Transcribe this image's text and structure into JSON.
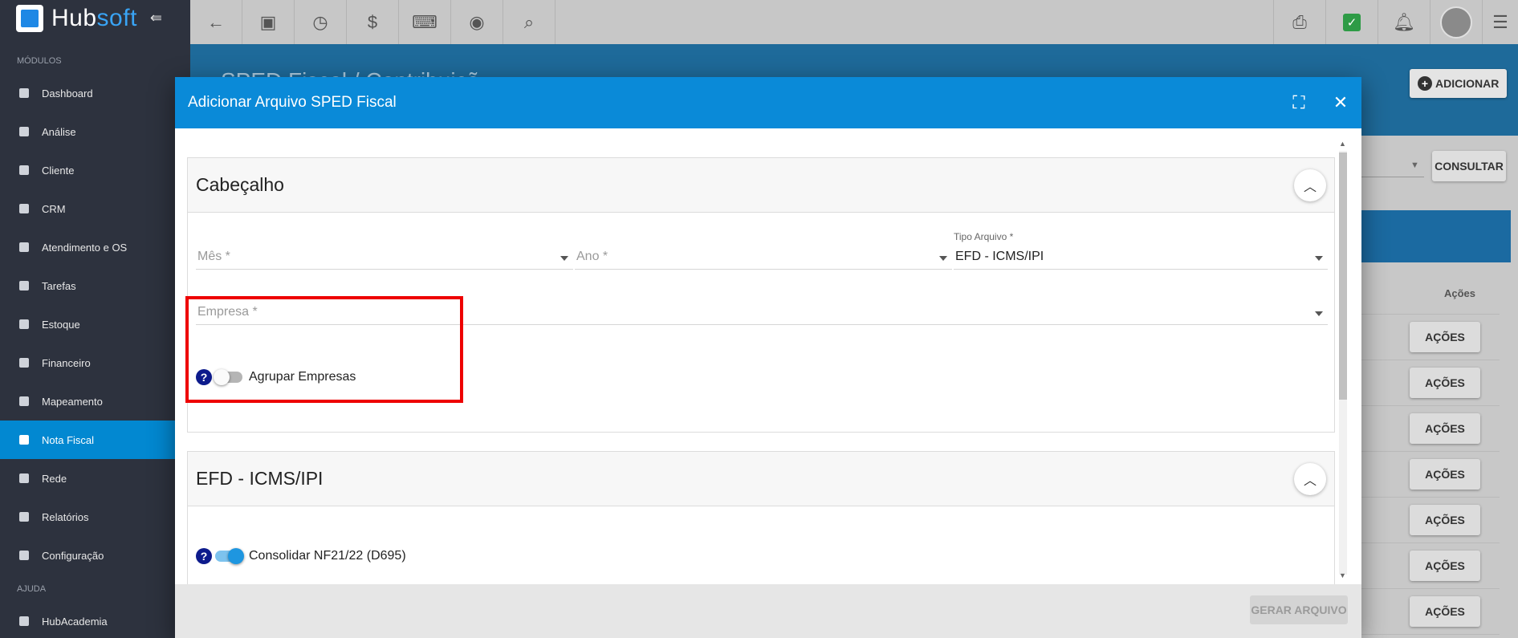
{
  "app": {
    "brand_hub": "Hub",
    "brand_soft": "soft",
    "collapse_icon": "⇚"
  },
  "sidebar": {
    "section_modules": "MÓDULOS",
    "section_help": "AJUDA",
    "items": [
      {
        "label": "Dashboard",
        "icon": "dashboard-icon",
        "has_chevron": false
      },
      {
        "label": "Análise",
        "icon": "pie-chart-icon",
        "has_chevron": false
      },
      {
        "label": "Cliente",
        "icon": "contact-card-icon",
        "has_chevron": true
      },
      {
        "label": "CRM",
        "icon": "kanban-icon",
        "has_chevron": false
      },
      {
        "label": "Atendimento e OS",
        "icon": "calendar-clock-icon",
        "has_chevron": false
      },
      {
        "label": "Tarefas",
        "icon": "task-icon",
        "has_chevron": false
      },
      {
        "label": "Estoque",
        "icon": "box-icon",
        "has_chevron": false
      },
      {
        "label": "Financeiro",
        "icon": "money-icon",
        "has_chevron": false
      },
      {
        "label": "Mapeamento",
        "icon": "map-pin-icon",
        "has_chevron": false
      },
      {
        "label": "Nota Fiscal",
        "icon": "invoice-icon",
        "has_chevron": false,
        "active": true
      },
      {
        "label": "Rede",
        "icon": "server-icon",
        "has_chevron": false
      },
      {
        "label": "Relatórios",
        "icon": "report-icon",
        "has_chevron": false
      },
      {
        "label": "Configuração",
        "icon": "gear-icon",
        "has_chevron": true
      }
    ],
    "help_items": [
      {
        "label": "HubAcademia",
        "icon": "video-icon"
      }
    ]
  },
  "topbar": {
    "left_icons": [
      "back-arrow-icon",
      "contact-icon",
      "calendar-clock-icon",
      "dollar-icon",
      "terminal-icon",
      "eye-icon",
      "search-icon"
    ],
    "right_icons": [
      "pdf-icon",
      "check-icon",
      "bell-icon",
      "avatar",
      "list-icon"
    ]
  },
  "page": {
    "title": "SPED Fiscal / Contribuiçõ",
    "add_button": "ADICIONAR",
    "consultar_button": "CONSULTAR",
    "table_actions_header": "Ações",
    "row_action_label": "AÇÕES",
    "row_count": 7
  },
  "modal": {
    "title": "Adicionar Arquivo SPED Fiscal",
    "header_section": {
      "title": "Cabeçalho",
      "mes_placeholder": "Mês *",
      "ano_placeholder": "Ano *",
      "tipo_label": "Tipo Arquivo *",
      "tipo_value": "EFD - ICMS/IPI",
      "empresa_placeholder": "Empresa *",
      "agrupar_label": "Agrupar Empresas",
      "agrupar_on": false
    },
    "efd_section": {
      "title": "EFD - ICMS/IPI",
      "consolidar_label": "Consolidar NF21/22 (D695)",
      "consolidar_on": true
    },
    "footer": {
      "generate_button": "GERAR ARQUIVO"
    }
  },
  "colors": {
    "accent": "#0a8ad8",
    "sidebar_bg": "#2d323e",
    "highlight": "#ee0000",
    "help_icon": "#0d1b8c"
  }
}
